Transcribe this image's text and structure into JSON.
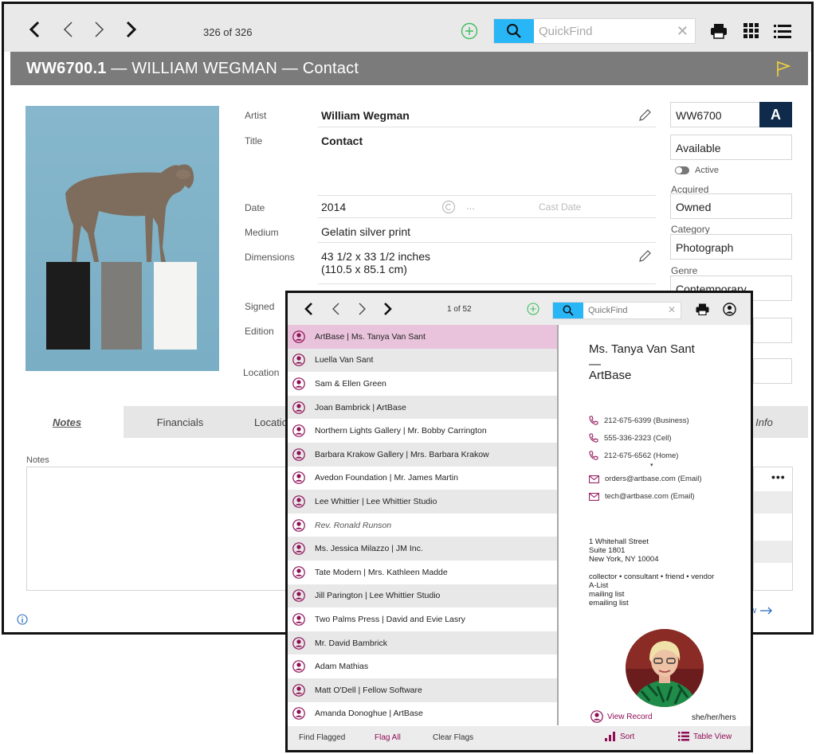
{
  "main": {
    "record_count": "326 of 326",
    "quickfind_placeholder": "QuickFind",
    "title_id": "WW6700.1",
    "title_rest": " — WILLIAM WEGMAN — Contact",
    "fields": {
      "artist_label": "Artist",
      "artist_value": "William Wegman",
      "title_label": "Title",
      "title_value": "Contact",
      "date_label": "Date",
      "date_value": "2014",
      "date_more": "...",
      "cast_date": "Cast Date",
      "medium_label": "Medium",
      "medium_value": "Gelatin silver print",
      "dimensions_label": "Dimensions",
      "dimensions_line1": "43 1/2 x 33 1/2 inches",
      "dimensions_line2": "(110.5 x 85.1 cm)",
      "signed_label": "Signed",
      "edition_label": "Edition",
      "location_label": "Location"
    },
    "right": {
      "inventory": "WW6700",
      "badge": "A",
      "status": "Available",
      "active_label": "Active",
      "acquired_label": "Acquired",
      "acquired_value": "Owned",
      "category_label": "Category",
      "category_value": "Photograph",
      "genre_label": "Genre",
      "genre_value": "Contemporary"
    },
    "tabs": [
      "Notes",
      "Financials",
      "Location",
      "Info"
    ],
    "notes_label": "Notes",
    "view_link": "ew",
    "colors": {
      "accent": "#29b6f6",
      "title_bar": "#7b7b7b",
      "flag": "#f2d43a",
      "add": "#3fbf5f"
    }
  },
  "contacts": {
    "record_count": "1 of 52",
    "quickfind_placeholder": "QuickFind",
    "rows": [
      "ArtBase | Ms. Tanya Van Sant",
      "Luella Van Sant",
      "Sam & Ellen Green",
      "Joan Bambrick | ArtBase",
      "Northern Lights Gallery | Mr. Bobby Carrington",
      "Barbara Krakow Gallery | Mrs. Barbara Krakow",
      "Avedon Foundation | Mr. James Martin",
      "Lee Whittier | Lee Whittier Studio",
      "Rev. Ronald Runson",
      "Ms. Jessica Milazzo | JM Inc.",
      "Tate Modern | Mrs. Kathleen Madde",
      "Jill Parington | Lee Whittier Studio",
      "Two Palms Press | David and Evie Lasry",
      "Mr. David Bambrick",
      "Adam Mathias",
      "Matt O'Dell | Fellow Software",
      "Amanda Donoghue | ArtBase"
    ],
    "detail": {
      "name": "Ms. Tanya Van Sant",
      "separator": "—",
      "org": "ArtBase",
      "phones": [
        "212-675-6399 (Business)",
        "555-336-2323 (Cell)",
        "212-675-6562 (Home)"
      ],
      "emails": [
        "orders@artbase.com (Email)",
        "tech@artbase.com (Email)"
      ],
      "address": [
        "1 Whitehall Street",
        "Suite 1801",
        "New York, NY 10004"
      ],
      "tags": [
        "collector • consultant • friend • vendor",
        "A-List",
        "mailing list",
        "emailing list"
      ],
      "view_record": "View Record",
      "pronouns": "she/her/hers"
    },
    "bottom": {
      "find_flagged": "Find Flagged",
      "flag_all": "Flag All",
      "clear_flags": "Clear Flags",
      "sort": "Sort",
      "table_view": "Table View"
    },
    "colors": {
      "brand": "#8e0e56",
      "selected": "#e9c3dc"
    }
  }
}
